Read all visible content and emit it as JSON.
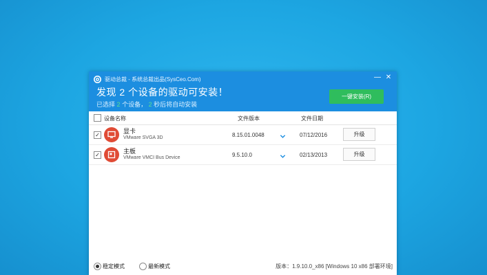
{
  "window": {
    "title": "驱动总裁 - 系统总裁出品(SysCeo.Com)",
    "minimize": "—",
    "close": "✕"
  },
  "header": {
    "headline": "发现  2  个设备的驱动可安装！",
    "selected_prefix": "已选择",
    "selected_count": "2",
    "selected_suffix": "个设备，",
    "seconds_count": "2",
    "seconds_suffix": "秒后将自动安装",
    "install_button": "一键安装(R)",
    "accent_color": "#1c8ee0",
    "button_color": "#2fbd5d"
  },
  "table": {
    "columns": [
      "设备名称",
      "文件版本",
      "文件日期"
    ],
    "rows": [
      {
        "name": "显卡",
        "desc": "VMware SVGA 3D",
        "version": "8.15.01.0048",
        "date": "07/12/2016",
        "action": "升级",
        "checked": "✓",
        "icon": "monitor-icon"
      },
      {
        "name": "主板",
        "desc": "VMware VMCI Bus Device",
        "version": "9.5.10.0",
        "date": "02/13/2013",
        "action": "升级",
        "checked": "✓",
        "icon": "motherboard-icon"
      }
    ]
  },
  "footer": {
    "mode_stable": "稳定模式",
    "mode_latest": "最新模式",
    "selected_mode": "稳定模式",
    "version": "版本：1.9.10.0_x86 [Windows 10 x86 部署环境]"
  }
}
